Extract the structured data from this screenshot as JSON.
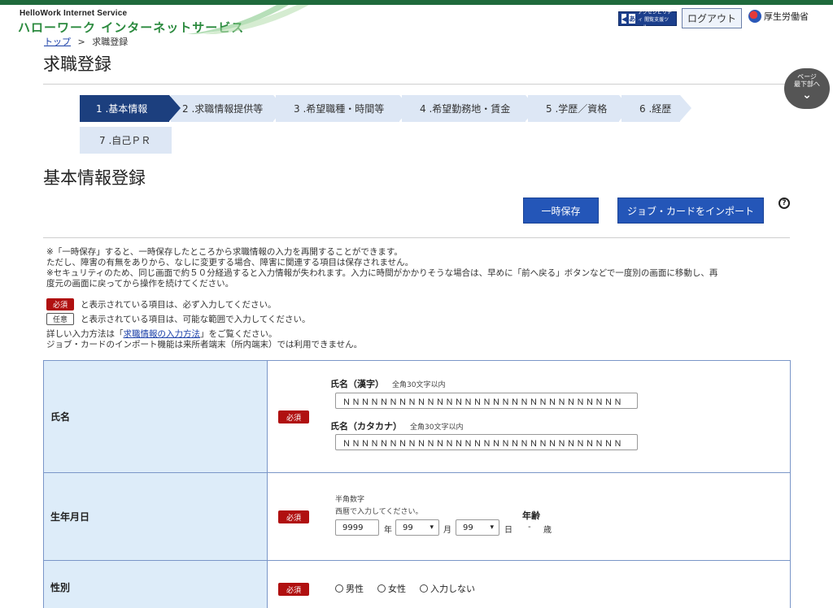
{
  "header": {
    "logo_sub": "HelloWork Internet Service",
    "logo_main": "ハローワーク インターネットサービス",
    "access_label": "アクセシビリティ 閲覧支援ツール",
    "logout_label": "ログアウト",
    "ministry_label": "厚生労働省"
  },
  "breadcrumb": {
    "top": "トップ",
    "separator": ">",
    "current": "求職登録"
  },
  "page_title": "求職登録",
  "page_bottom": {
    "line1": "ページ",
    "line2": "最下部へ"
  },
  "steps": [
    {
      "label": "1 .基本情報"
    },
    {
      "label": "2 .求職情報提供等"
    },
    {
      "label": "3 .希望職種・時間等"
    },
    {
      "label": "4 .希望勤務地・賃金"
    },
    {
      "label": "5 .学歴／資格"
    },
    {
      "label": "6 .経歴"
    },
    {
      "label": "7 .自己ＰＲ"
    }
  ],
  "section_title": "基本情報登録",
  "buttons": {
    "temp_save": "一時保存",
    "import_job_card": "ジョブ・カードをインポート"
  },
  "notes": [
    "※「一時保存」すると、一時保存したところから求職情報の入力を再開することができます。",
    "ただし、障害の有無をありから、なしに変更する場合、障害に関連する項目は保存されません。",
    "※セキュリティのため、同じ画面で約５０分経過すると入力情報が失われます。入力に時間がかかりそうな場合は、早めに「前へ戻る」ボタンなどで一度別の画面に移動し、再",
    "度元の画面に戻ってから操作を続けてください。"
  ],
  "legend": {
    "required_badge": "必須",
    "required_text": "と表示されている項目は、必ず入力してください。",
    "optional_badge": "任意",
    "optional_text": "と表示されている項目は、可能な範囲で入力してください。"
  },
  "detail": {
    "prefix": "詳しい入力方法は「",
    "link": "求職情報の入力方法",
    "suffix": "」をご覧ください。",
    "line2": "ジョブ・カードのインポート機能は来所者端末（所内端末）では利用できません。"
  },
  "form": {
    "name": {
      "label": "氏名",
      "badge": "必須",
      "kanji_label": "氏名（漢字）",
      "kanji_hint": "全角30文字以内",
      "kanji_value": "ＮＮＮＮＮＮＮＮＮＮＮＮＮＮＮＮＮＮＮＮＮＮＮＮＮＮＮＮＮＮ",
      "kana_label": "氏名（カタカナ）",
      "kana_hint": "全角30文字以内",
      "kana_value": "ＮＮＮＮＮＮＮＮＮＮＮＮＮＮＮＮＮＮＮＮＮＮＮＮＮＮＮＮＮＮ"
    },
    "birth": {
      "label": "生年月日",
      "badge": "必須",
      "hint1": "半角数字",
      "hint2": "西暦で入力してください。",
      "year_value": "9999",
      "year_unit": "年",
      "month_value": "99",
      "month_unit": "月",
      "day_value": "99",
      "day_unit": "日",
      "age_label": "年齢",
      "age_value": "-",
      "age_unit": "歳"
    },
    "gender": {
      "label": "性別",
      "badge": "必須",
      "options": [
        "男性",
        "女性",
        "入力しない"
      ]
    }
  }
}
